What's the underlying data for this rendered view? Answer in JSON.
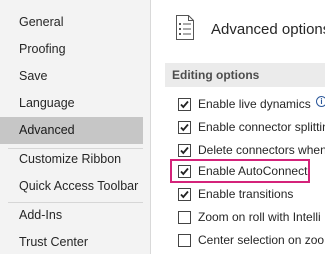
{
  "nav": {
    "items": [
      {
        "label": "General"
      },
      {
        "label": "Proofing"
      },
      {
        "label": "Save"
      },
      {
        "label": "Language"
      },
      {
        "label": "Advanced"
      },
      {
        "label": "Customize Ribbon"
      },
      {
        "label": "Quick Access Toolbar"
      },
      {
        "label": "Add-Ins"
      },
      {
        "label": "Trust Center"
      }
    ],
    "selected": "Advanced"
  },
  "header": {
    "title": "Advanced options f",
    "icon": "document-lines-icon"
  },
  "section": {
    "label": "Editing options"
  },
  "options": [
    {
      "label": "Enable live dynamics",
      "checked": true,
      "info_icon": "i"
    },
    {
      "label": "Enable connector splittin",
      "checked": true
    },
    {
      "label": "Delete connectors when",
      "checked": true
    },
    {
      "label": "Enable AutoConnect",
      "checked": true
    },
    {
      "label": "Enable transitions",
      "checked": true
    },
    {
      "label": "Zoom on roll with Intelli",
      "checked": false
    },
    {
      "label": "Center selection on zoo",
      "checked": false
    }
  ],
  "colors": {
    "nav_background": "#f3f3f3",
    "nav_selected": "#c6c6c6",
    "section_header": "#ebebeb",
    "highlight": "#d4237a"
  }
}
